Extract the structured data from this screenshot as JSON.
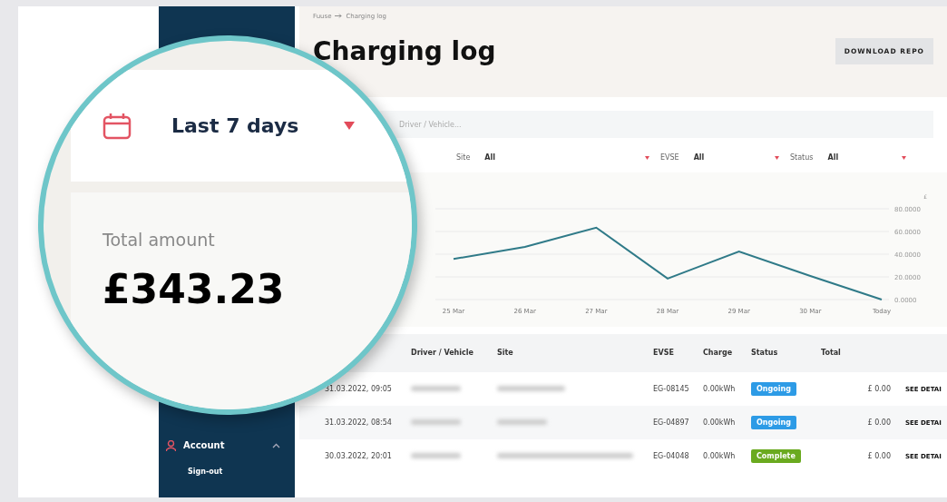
{
  "sidebar": {
    "items": [
      {
        "label": "Account",
        "expanded": true,
        "children": [
          {
            "label": "Sign-out"
          }
        ]
      }
    ]
  },
  "breadcrumb": [
    "Fuuse",
    "Charging log"
  ],
  "header": {
    "title": "Charging log",
    "button": "DOWNLOAD REPO"
  },
  "search": {
    "placeholder": "Driver / Vehicle..."
  },
  "filters": [
    {
      "label": "Site",
      "value": "All"
    },
    {
      "label": "EVSE",
      "value": "All"
    },
    {
      "label": "Status",
      "value": "All"
    }
  ],
  "chart": {
    "chart_data": {
      "type": "line",
      "ylabel": "£",
      "grid": true,
      "categories": [
        "25 Mar",
        "26 Mar",
        "27 Mar",
        "28 Mar",
        "29 Mar",
        "30 Mar",
        "Today"
      ],
      "series": [
        {
          "color": "#2f7a88",
          "values": [
            35.8,
            46.4,
            63.4,
            18.5,
            42.3,
            20.8,
            0
          ]
        }
      ],
      "ylim": [
        0,
        80
      ],
      "yticks": [
        {
          "value": 0,
          "label": "0.0000"
        },
        {
          "value": 20,
          "label": "20.0000"
        },
        {
          "value": 40,
          "label": "40.0000"
        },
        {
          "value": 60,
          "label": "60.0000"
        },
        {
          "value": 80,
          "label": "80.0000"
        }
      ]
    }
  },
  "table": {
    "columns": [
      "",
      "Driver / Vehicle",
      "Site",
      "EVSE",
      "Charge",
      "Status",
      "Total",
      ""
    ],
    "rows": [
      {
        "date": "31.03.2022, 09:05",
        "evse": "EG-08145",
        "charge": "0.00kWh",
        "status": "Ongoing",
        "kind": "ongoing",
        "total": "£ 0.00",
        "action": "SEE DETAI"
      },
      {
        "date": "31.03.2022, 08:54",
        "evse": "EG-04897",
        "charge": "0.00kWh",
        "status": "Ongoing",
        "kind": "ongoing",
        "total": "£ 0.00",
        "action": "SEE DETAI"
      },
      {
        "date": "30.03.2022, 20:01",
        "evse": "EG-04048",
        "charge": "0.00kWh",
        "status": "Complete",
        "kind": "complete",
        "total": "£ 0.00",
        "action": "SEE DETAI"
      }
    ]
  },
  "magnifier": {
    "period": "Last 7 days",
    "total_label": "Total amount",
    "total_value": "£343.23"
  }
}
